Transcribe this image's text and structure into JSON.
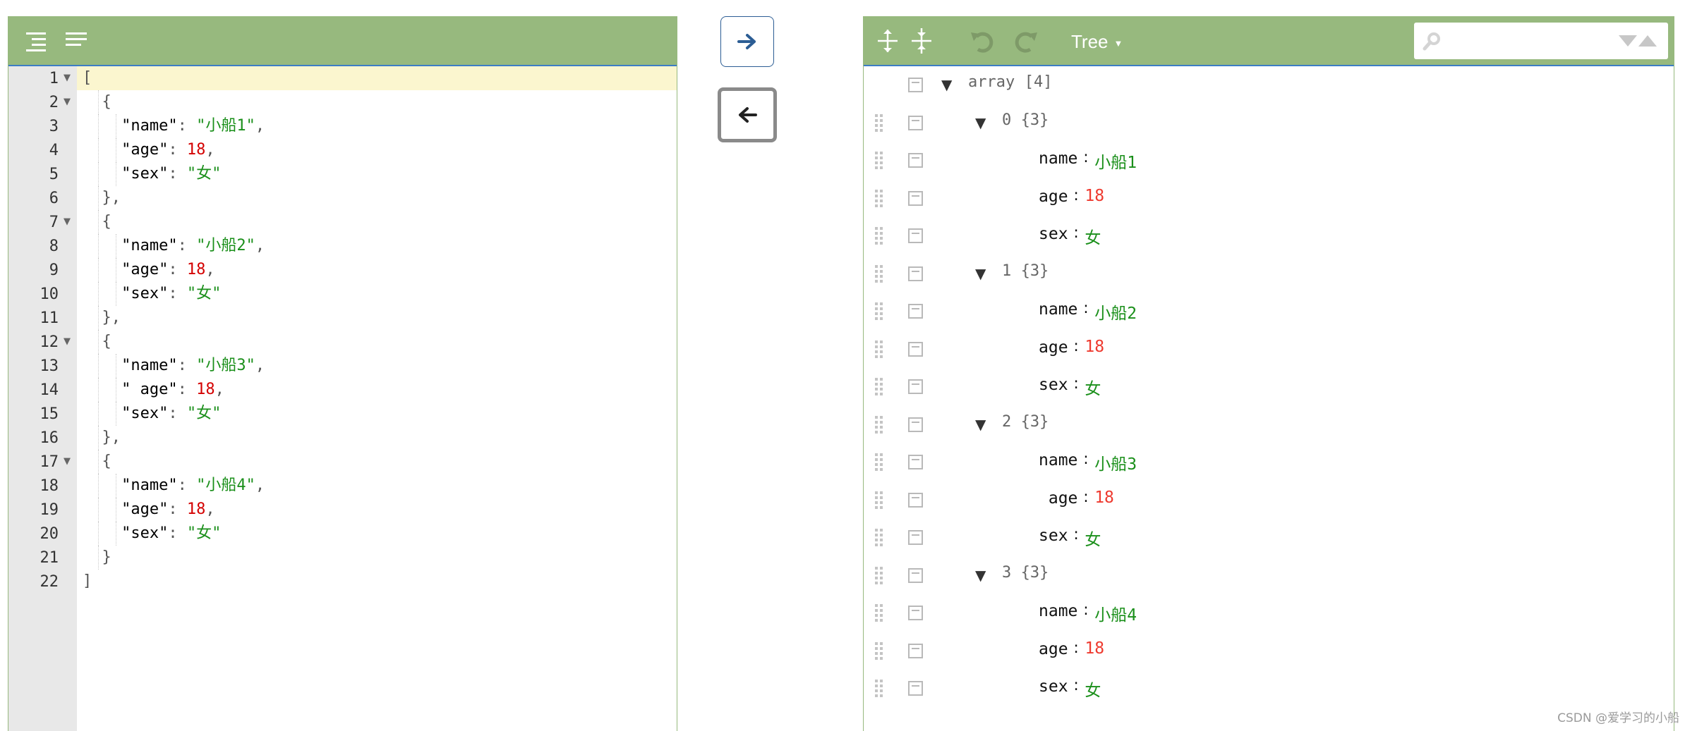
{
  "left_editor": {
    "toolbar": [
      {
        "name": "format-icon"
      },
      {
        "name": "compact-icon"
      }
    ],
    "active_line": 1,
    "lines": [
      {
        "n": "1",
        "fold": true,
        "indent": 0,
        "tokens": [
          [
            "p",
            "["
          ]
        ]
      },
      {
        "n": "2",
        "fold": true,
        "indent": 1,
        "tokens": [
          [
            "p",
            "{"
          ]
        ]
      },
      {
        "n": "3",
        "fold": false,
        "indent": 2,
        "tokens": [
          [
            "k",
            "\"name\""
          ],
          [
            "p",
            ": "
          ],
          [
            "s",
            "\"小船1\""
          ],
          [
            "p",
            ","
          ]
        ]
      },
      {
        "n": "4",
        "fold": false,
        "indent": 2,
        "tokens": [
          [
            "k",
            "\"age\""
          ],
          [
            "p",
            ": "
          ],
          [
            "n",
            "18"
          ],
          [
            "p",
            ","
          ]
        ]
      },
      {
        "n": "5",
        "fold": false,
        "indent": 2,
        "tokens": [
          [
            "k",
            "\"sex\""
          ],
          [
            "p",
            ": "
          ],
          [
            "s",
            "\"女\""
          ]
        ]
      },
      {
        "n": "6",
        "fold": false,
        "indent": 1,
        "tokens": [
          [
            "p",
            "},"
          ]
        ]
      },
      {
        "n": "7",
        "fold": true,
        "indent": 1,
        "tokens": [
          [
            "p",
            "{"
          ]
        ]
      },
      {
        "n": "8",
        "fold": false,
        "indent": 2,
        "tokens": [
          [
            "k",
            "\"name\""
          ],
          [
            "p",
            ": "
          ],
          [
            "s",
            "\"小船2\""
          ],
          [
            "p",
            ","
          ]
        ]
      },
      {
        "n": "9",
        "fold": false,
        "indent": 2,
        "tokens": [
          [
            "k",
            "\"age\""
          ],
          [
            "p",
            ": "
          ],
          [
            "n",
            "18"
          ],
          [
            "p",
            ","
          ]
        ]
      },
      {
        "n": "10",
        "fold": false,
        "indent": 2,
        "tokens": [
          [
            "k",
            "\"sex\""
          ],
          [
            "p",
            ": "
          ],
          [
            "s",
            "\"女\""
          ]
        ]
      },
      {
        "n": "11",
        "fold": false,
        "indent": 1,
        "tokens": [
          [
            "p",
            "},"
          ]
        ]
      },
      {
        "n": "12",
        "fold": true,
        "indent": 1,
        "tokens": [
          [
            "p",
            "{"
          ]
        ]
      },
      {
        "n": "13",
        "fold": false,
        "indent": 2,
        "tokens": [
          [
            "k",
            "\"name\""
          ],
          [
            "p",
            ": "
          ],
          [
            "s",
            "\"小船3\""
          ],
          [
            "p",
            ","
          ]
        ]
      },
      {
        "n": "14",
        "fold": false,
        "indent": 2,
        "tokens": [
          [
            "k",
            "\" age\""
          ],
          [
            "p",
            ": "
          ],
          [
            "n",
            "18"
          ],
          [
            "p",
            ","
          ]
        ]
      },
      {
        "n": "15",
        "fold": false,
        "indent": 2,
        "tokens": [
          [
            "k",
            "\"sex\""
          ],
          [
            "p",
            ": "
          ],
          [
            "s",
            "\"女\""
          ]
        ]
      },
      {
        "n": "16",
        "fold": false,
        "indent": 1,
        "tokens": [
          [
            "p",
            "},"
          ]
        ]
      },
      {
        "n": "17",
        "fold": true,
        "indent": 1,
        "tokens": [
          [
            "p",
            "{"
          ]
        ]
      },
      {
        "n": "18",
        "fold": false,
        "indent": 2,
        "tokens": [
          [
            "k",
            "\"name\""
          ],
          [
            "p",
            ": "
          ],
          [
            "s",
            "\"小船4\""
          ],
          [
            "p",
            ","
          ]
        ]
      },
      {
        "n": "19",
        "fold": false,
        "indent": 2,
        "tokens": [
          [
            "k",
            "\"age\""
          ],
          [
            "p",
            ": "
          ],
          [
            "n",
            "18"
          ],
          [
            "p",
            ","
          ]
        ]
      },
      {
        "n": "20",
        "fold": false,
        "indent": 2,
        "tokens": [
          [
            "k",
            "\"sex\""
          ],
          [
            "p",
            ": "
          ],
          [
            "s",
            "\"女\""
          ]
        ]
      },
      {
        "n": "21",
        "fold": false,
        "indent": 1,
        "tokens": [
          [
            "p",
            "}"
          ]
        ]
      },
      {
        "n": "22",
        "fold": false,
        "indent": 0,
        "tokens": [
          [
            "p",
            "]"
          ]
        ]
      }
    ]
  },
  "transfer": {
    "copy_right_icon": "arrow-right-icon",
    "copy_left_icon": "arrow-left-icon"
  },
  "right_editor": {
    "toolbar": {
      "expand_all_icon": "expand-all-icon",
      "collapse_all_icon": "collapse-all-icon",
      "undo_icon": "undo-icon",
      "redo_icon": "redo-icon",
      "mode_label": "Tree",
      "search_value": ""
    },
    "rows": [
      {
        "type": "root",
        "idx": "array",
        "count": "[4]",
        "drag": false
      },
      {
        "type": "obj",
        "idx": "0",
        "count": "{3}"
      },
      {
        "type": "field",
        "key": "name",
        "keytext": "name",
        "vtype": "s",
        "value": "小船1"
      },
      {
        "type": "field",
        "key": "age",
        "keytext": "age",
        "vtype": "n",
        "value": "18"
      },
      {
        "type": "field",
        "key": "sex",
        "keytext": "sex",
        "vtype": "s",
        "value": "女"
      },
      {
        "type": "obj",
        "idx": "1",
        "count": "{3}"
      },
      {
        "type": "field",
        "key": "name",
        "keytext": "name",
        "vtype": "s",
        "value": "小船2"
      },
      {
        "type": "field",
        "key": "age",
        "keytext": "age",
        "vtype": "n",
        "value": "18"
      },
      {
        "type": "field",
        "key": "sex",
        "keytext": "sex",
        "vtype": "s",
        "value": "女"
      },
      {
        "type": "obj",
        "idx": "2",
        "count": "{3}"
      },
      {
        "type": "field",
        "key": "name",
        "keytext": "name",
        "vtype": "s",
        "value": "小船3"
      },
      {
        "type": "field",
        "key": "age",
        "keytext": " age",
        "vtype": "n",
        "value": "18"
      },
      {
        "type": "field",
        "key": "sex",
        "keytext": "sex",
        "vtype": "s",
        "value": "女"
      },
      {
        "type": "obj",
        "idx": "3",
        "count": "{3}"
      },
      {
        "type": "field",
        "key": "name",
        "keytext": "name",
        "vtype": "s",
        "value": "小船4"
      },
      {
        "type": "field",
        "key": "age",
        "keytext": "age",
        "vtype": "n",
        "value": "18"
      },
      {
        "type": "field",
        "key": "sex",
        "keytext": "sex",
        "vtype": "s",
        "value": "女"
      }
    ]
  },
  "watermark": "CSDN @爱学习的小船"
}
